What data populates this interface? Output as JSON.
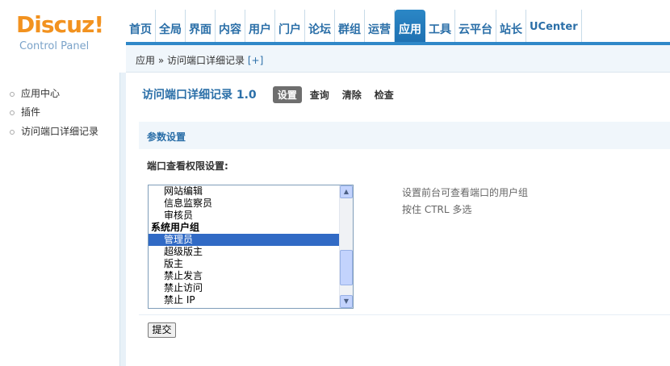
{
  "logo": {
    "brand": "Discuz!",
    "sub": "Control Panel"
  },
  "nav": {
    "items": [
      {
        "label": "首页"
      },
      {
        "label": "全局"
      },
      {
        "label": "界面"
      },
      {
        "label": "内容"
      },
      {
        "label": "用户"
      },
      {
        "label": "门户"
      },
      {
        "label": "论坛"
      },
      {
        "label": "群组"
      },
      {
        "label": "运营"
      },
      {
        "label": "应用"
      },
      {
        "label": "工具"
      },
      {
        "label": "云平台"
      },
      {
        "label": "站长"
      },
      {
        "label": "UCenter"
      }
    ],
    "active": "应用"
  },
  "breadcrumb": {
    "root": "应用",
    "sep": "»",
    "current": "访问端口详细记录",
    "add": "[+]"
  },
  "sidebar": {
    "items": [
      {
        "label": "应用中心"
      },
      {
        "label": "插件"
      },
      {
        "label": "访问端口详细记录"
      }
    ]
  },
  "main": {
    "title": "访问端口详细记录 1.0",
    "tabs": [
      {
        "label": "设置",
        "active": true
      },
      {
        "label": "查询"
      },
      {
        "label": "清除"
      },
      {
        "label": "检查"
      }
    ],
    "section_title": "参数设置",
    "field_label": "端口查看权限设置:",
    "listbox_options": [
      {
        "label": "网站编辑"
      },
      {
        "label": "信息监察员"
      },
      {
        "label": "审核员"
      },
      {
        "label": "系统用户组",
        "group": true
      },
      {
        "label": "管理员",
        "selected": true
      },
      {
        "label": "超级版主"
      },
      {
        "label": "版主"
      },
      {
        "label": "禁止发言"
      },
      {
        "label": "禁止访问"
      },
      {
        "label": "禁止 IP"
      }
    ],
    "hint_line1": "设置前台可查看端口的用户组",
    "hint_line2": "按住 CTRL 多选",
    "submit_label": "提交"
  },
  "colors": {
    "accent": "#2b6fa8",
    "brand": "#f2921f",
    "nav_active": "#2b87c6",
    "selection": "#316ac5"
  }
}
